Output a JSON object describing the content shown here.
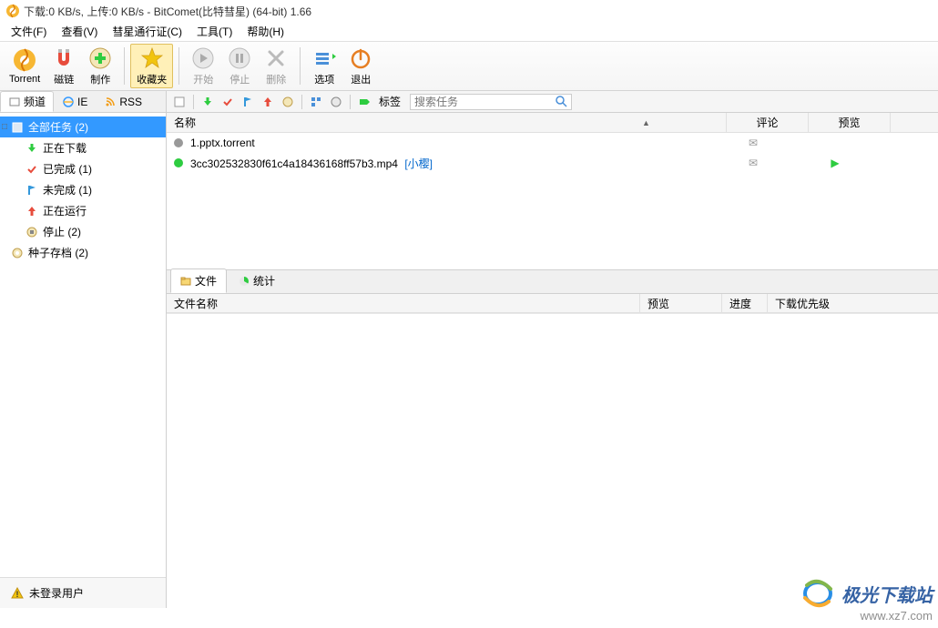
{
  "title": "下载:0 KB/s, 上传:0 KB/s - BitComet(比特彗星) (64-bit) 1.66",
  "menu": [
    "文件(F)",
    "查看(V)",
    "彗星通行证(C)",
    "工具(T)",
    "帮助(H)"
  ],
  "toolbar": {
    "torrent": "Torrent",
    "magnet": "磁链",
    "make": "制作",
    "favorites": "收藏夹",
    "start": "开始",
    "stop": "停止",
    "delete": "删除",
    "options": "选项",
    "exit": "退出"
  },
  "sidebar": {
    "tabs": {
      "channel": "频道",
      "ie": "IE",
      "rss": "RSS"
    },
    "tree": {
      "all": "全部任务 (2)",
      "downloading": "正在下载",
      "done": "已完成 (1)",
      "undone": "未完成 (1)",
      "active": "正在运行",
      "stopped": "停止 (2)",
      "seeds": "种子存档 (2)"
    },
    "status": "未登录用户"
  },
  "filterbar": {
    "labels": "标签",
    "search_placeholder": "搜索任务"
  },
  "task_header": {
    "name": "名称",
    "comment": "评论",
    "preview": "预览"
  },
  "tasks": [
    {
      "name": "1.pptx.torrent",
      "link": "",
      "status": "gray",
      "comment_icon": true,
      "preview_icon": false
    },
    {
      "name": "3cc302532830f61c4a18436168ff57b3.mp4",
      "link": "[小樱]",
      "status": "green",
      "comment_icon": true,
      "preview_icon": true
    }
  ],
  "detail_tabs": {
    "files": "文件",
    "stats": "统计"
  },
  "detail_header": {
    "filename": "文件名称",
    "preview": "预览",
    "progress": "进度",
    "priority": "下载优先级"
  },
  "watermark": {
    "text": "极光下载站",
    "url": "www.xz7.com"
  }
}
